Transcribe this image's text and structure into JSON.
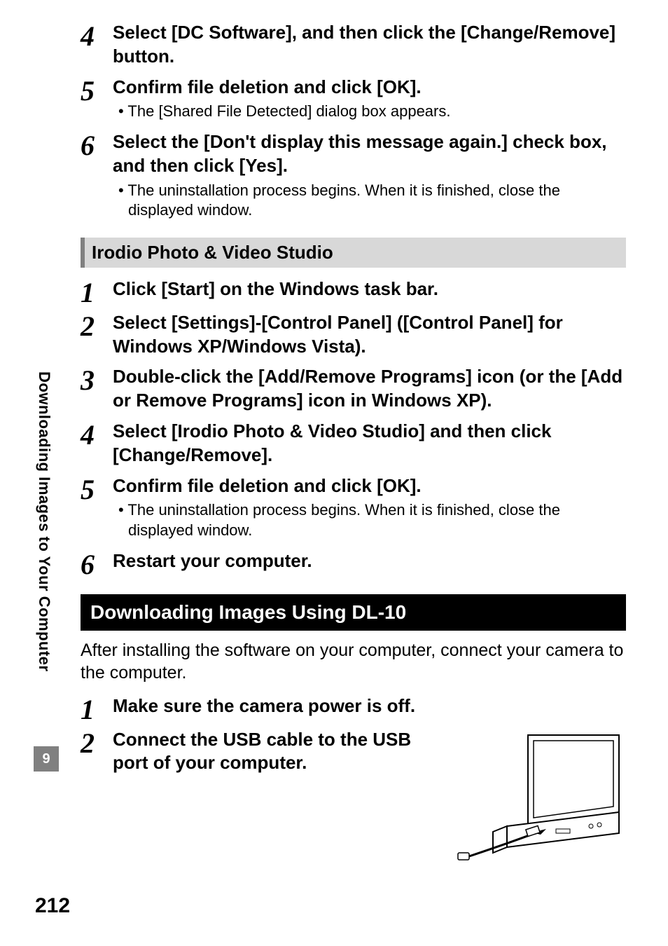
{
  "sidebar_label": "Downloading Images to Your Computer",
  "chapter_number": "9",
  "page_number": "212",
  "top_steps": [
    {
      "num": "4",
      "title": "Select [DC Software], and then click the [Change/Remove] button.",
      "notes": []
    },
    {
      "num": "5",
      "title": "Confirm file deletion and click [OK].",
      "notes": [
        "The [Shared File Detected] dialog box appears."
      ]
    },
    {
      "num": "6",
      "title": "Select the [Don't display this message again.] check box, and then click [Yes].",
      "notes": [
        "The uninstallation process begins. When it is finished, close the displayed window."
      ]
    }
  ],
  "section_irodio": "Irodio Photo & Video Studio",
  "irodio_steps": [
    {
      "num": "1",
      "title": "Click [Start] on the Windows task bar.",
      "notes": []
    },
    {
      "num": "2",
      "title": "Select [Settings]-[Control Panel] ([Control Panel] for Windows XP/Windows Vista).",
      "notes": []
    },
    {
      "num": "3",
      "title": "Double-click the [Add/Remove Programs] icon (or the [Add or Remove Programs] icon in Windows XP).",
      "notes": []
    },
    {
      "num": "4",
      "title": "Select [Irodio Photo & Video Studio] and then click [Change/Remove].",
      "notes": []
    },
    {
      "num": "5",
      "title": "Confirm file deletion and click [OK].",
      "notes": [
        "The uninstallation process begins. When it is finished, close the displayed window."
      ]
    },
    {
      "num": "6",
      "title": "Restart your computer.",
      "notes": []
    }
  ],
  "section_download": "Downloading Images Using DL-10",
  "download_intro": "After installing the software on your computer, connect your camera to the computer.",
  "download_steps": [
    {
      "num": "1",
      "title": "Make sure the camera power is off."
    },
    {
      "num": "2",
      "title": "Connect the USB cable to the USB port of your computer."
    }
  ]
}
